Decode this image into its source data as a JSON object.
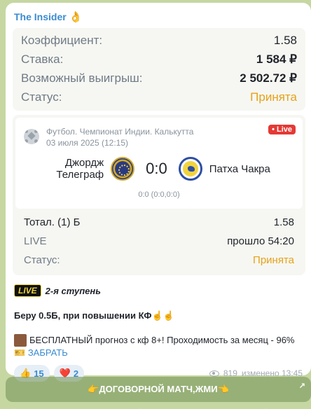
{
  "sender": {
    "name": "The Insider",
    "emoji": "👌"
  },
  "bet": {
    "rows": [
      {
        "label": "Коэффициент:",
        "value": "1.58"
      },
      {
        "label": "Ставка:",
        "value": "1 584 ₽"
      },
      {
        "label": "Возможный выигрыш:",
        "value": "2 502.72 ₽"
      },
      {
        "label": "Статус:",
        "value": "Принята"
      }
    ]
  },
  "match": {
    "league": "Футбол. Чемпионат Индии. Калькутта",
    "date": "03 июля 2025 (12:15)",
    "live_badge": "• Live",
    "team_home": "Джордж Телеграф",
    "team_away": "Патха Чакра",
    "score": "0:0",
    "sub_score": "0:0 (0:0,0:0)",
    "stats": [
      {
        "label": "Тотал. (1) Б",
        "value": "1.58"
      },
      {
        "label": "LIVE",
        "value": "прошло 54:20"
      },
      {
        "label": "Статус:",
        "value": "Принята"
      }
    ]
  },
  "message": {
    "live_tag": "LIVE",
    "step": "2-я ступень",
    "take": "Беру 0.5Б, при повышении КФ☝️☝️",
    "promo": "БЕСПЛАТНЫЙ прогноз с кф 8+! Проходимость за месяц - 96%",
    "promo_link_emoji": "🎫",
    "promo_link": "ЗАБРАТЬ"
  },
  "reactions": [
    {
      "emoji": "👍",
      "count": "15"
    },
    {
      "emoji": "❤️",
      "count": "2"
    }
  ],
  "meta": {
    "views": "819",
    "edited": "изменено 13:45"
  },
  "cta": {
    "label": "👉ДОГОВОРНОЙ МАТЧ,ЖМИ👈",
    "arrow": "↗"
  }
}
